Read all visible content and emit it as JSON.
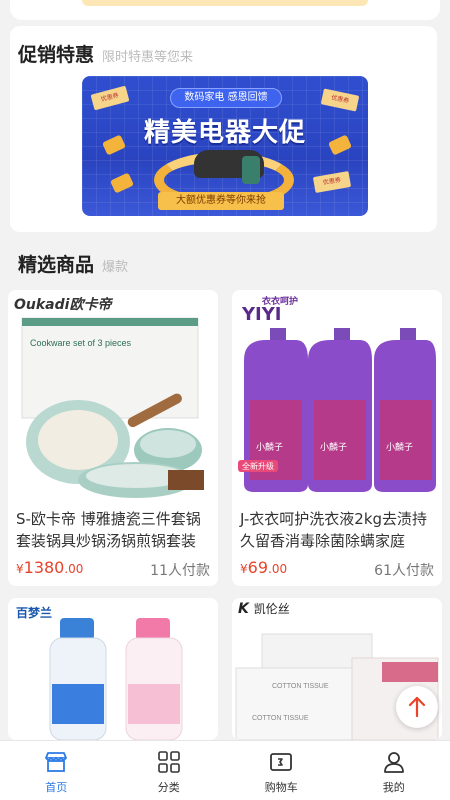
{
  "promo": {
    "title": "促销特惠",
    "subtitle": "限时特惠等您来",
    "banner": {
      "pill": "数码家电 感恩回馈",
      "headline": "精美电器大促",
      "ribbon": "大额优惠券等你来抢",
      "ticket": "优惠券"
    }
  },
  "featured": {
    "title": "精选商品",
    "subtitle": "爆款"
  },
  "products": [
    {
      "name": "S-欧卡帝 博雅搪瓷三件套锅套装锅具炒锅汤锅煎锅套装",
      "currency": "¥",
      "price_int": "1380",
      "price_dec": ".00",
      "sold": "11人付款",
      "brand_latin": "Oukadi",
      "brand_cn": "欧卡帝",
      "box_text": "Cookware set of 3 pieces"
    },
    {
      "name": "J-衣衣呵护洗衣液2kg去渍持久留香消毒除菌除螨家庭",
      "currency": "¥",
      "price_int": "69",
      "price_dec": ".00",
      "sold": "61人付款",
      "brand_top": "衣衣呵护",
      "brand_latin": "YIYI",
      "badge": "全新升级",
      "bottle_cn": "小麟子"
    },
    {
      "brand_cn": "百梦兰"
    },
    {
      "brand_latin": "K",
      "brand_cn": "凯伦丝",
      "pack_text": "COTTON TISSUE"
    }
  ],
  "tabbar": [
    {
      "label": "首页",
      "icon": "home-shop-icon",
      "active": true
    },
    {
      "label": "分类",
      "icon": "category-grid-icon",
      "active": false
    },
    {
      "label": "购物车",
      "icon": "cart-icon",
      "active": false
    },
    {
      "label": "我的",
      "icon": "user-icon",
      "active": false
    }
  ],
  "colors": {
    "accent": "#2c7be5",
    "price": "#e8442b",
    "banner": "#2f4fd0"
  }
}
